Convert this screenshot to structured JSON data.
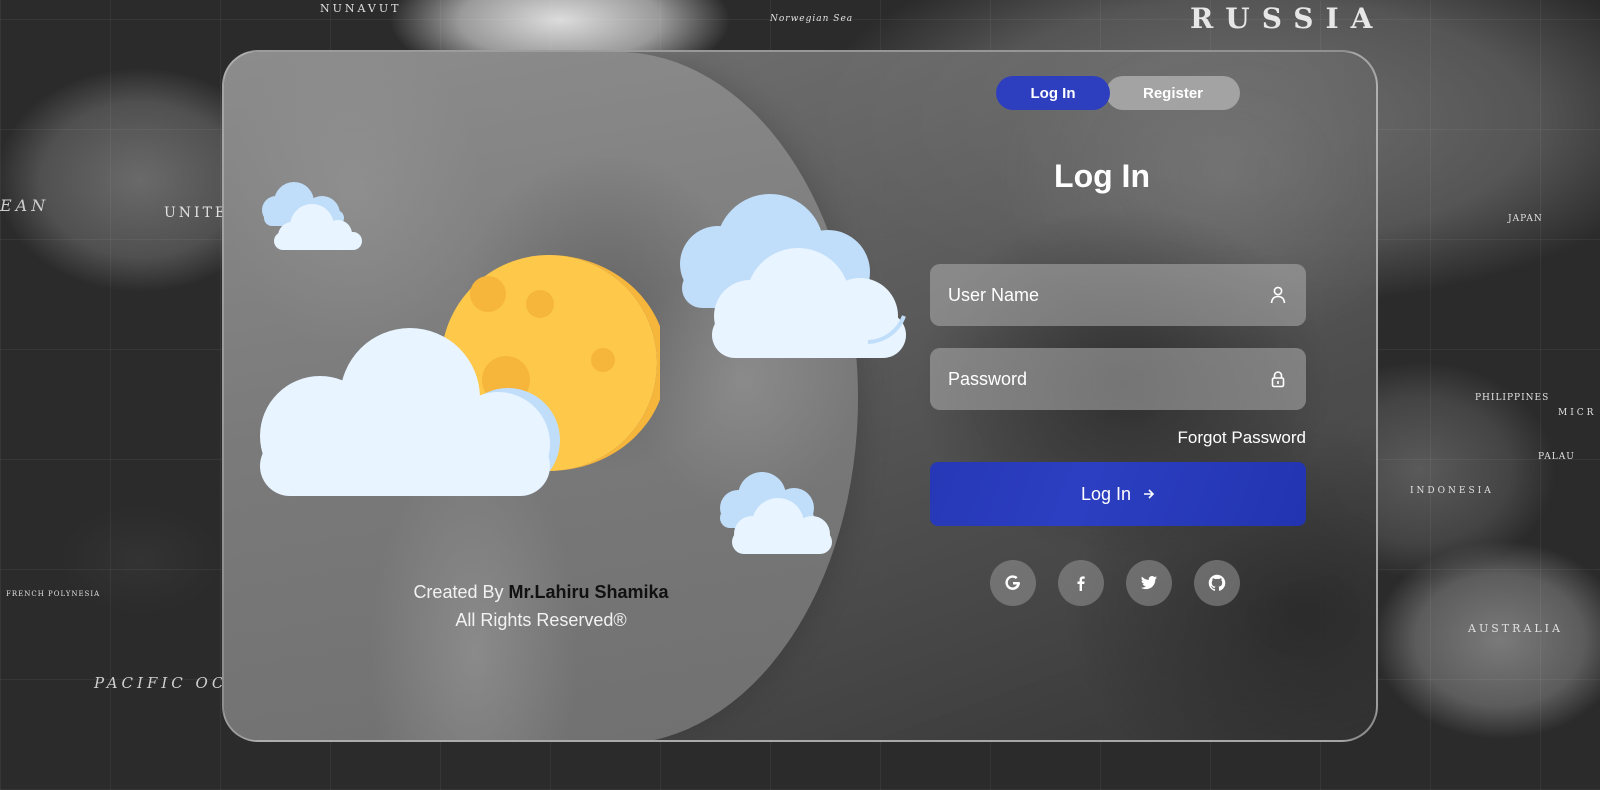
{
  "map": {
    "labels": [
      "RUSSIA",
      "NUNAVUT",
      "Norwegian Sea",
      "UNITE",
      "EAN",
      "JAPAN",
      "PHILIPPINES",
      "INDONESIA",
      "AUSTRALIA",
      "PACIFIC OC",
      "PALAU",
      "MICR",
      "FRENCH POLYNESIA"
    ]
  },
  "credit": {
    "prefix": "Created By",
    "author": "Mr.Lahiru Shamika",
    "rights": "All Rights Reserved®"
  },
  "toggle": {
    "login_label": "Log In",
    "register_label": "Register"
  },
  "form": {
    "title": "Log In",
    "username_placeholder": "User Name",
    "password_placeholder": "Password",
    "forgot_label": "Forgot Password",
    "submit_label": "Log In"
  },
  "social": [
    {
      "icon": "google-icon"
    },
    {
      "icon": "facebook-icon"
    },
    {
      "icon": "twitter-icon"
    },
    {
      "icon": "github-icon"
    }
  ],
  "colors": {
    "accent": "#2d3fbf",
    "moon": "#fec84a",
    "cloud": "#e8f4ff",
    "cloud_shade": "#c0defa"
  }
}
